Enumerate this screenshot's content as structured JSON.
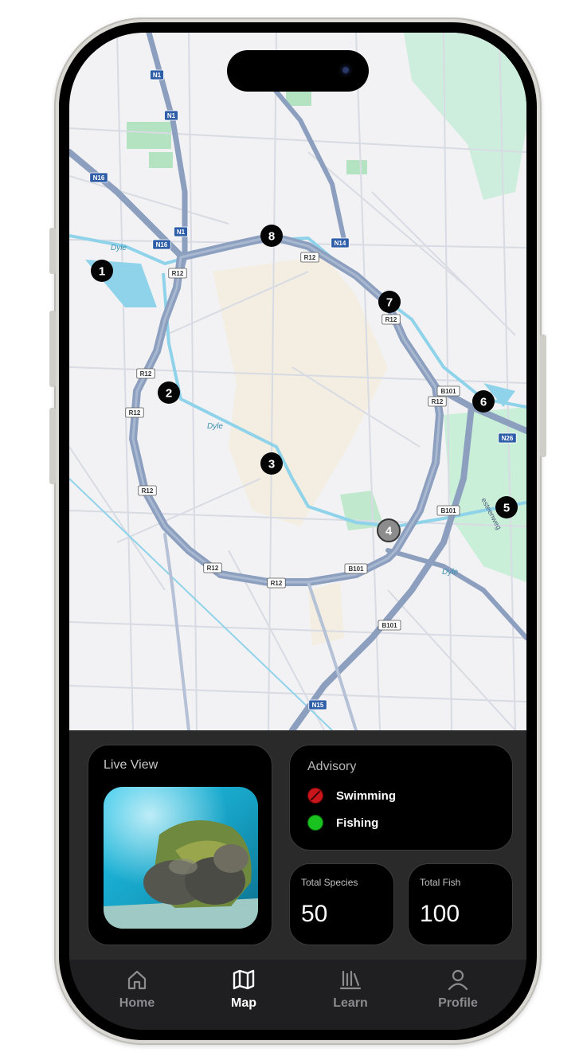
{
  "map": {
    "road_labels": [
      "N1",
      "N1",
      "N1",
      "N16",
      "N16",
      "N14",
      "R12",
      "R12",
      "R12",
      "R12",
      "R12",
      "R12",
      "R12",
      "R12",
      "R12",
      "B101",
      "B101",
      "B101",
      "B101",
      "N15",
      "N26",
      "Dyle",
      "Dyle",
      "Dyle",
      "esteenweg"
    ],
    "markers": [
      {
        "label": "1",
        "style": "dark"
      },
      {
        "label": "2",
        "style": "dark"
      },
      {
        "label": "3",
        "style": "dark"
      },
      {
        "label": "4",
        "style": "gray"
      },
      {
        "label": "5",
        "style": "dark"
      },
      {
        "label": "6",
        "style": "dark"
      },
      {
        "label": "7",
        "style": "dark"
      },
      {
        "label": "8",
        "style": "dark"
      }
    ]
  },
  "live_view": {
    "title": "Live View"
  },
  "advisory": {
    "title": "Advisory",
    "items": [
      {
        "label": "Swimming",
        "status": "prohibited",
        "color": "#c8161c"
      },
      {
        "label": "Fishing",
        "status": "allowed",
        "color": "#19c21f"
      }
    ]
  },
  "stats": {
    "total_species": {
      "label": "Total Species",
      "value": "50"
    },
    "total_fish": {
      "label": "Total Fish",
      "value": "100"
    }
  },
  "tabbar": {
    "tabs": [
      {
        "label": "Home",
        "icon": "home-icon",
        "active": false
      },
      {
        "label": "Map",
        "icon": "map-icon",
        "active": true
      },
      {
        "label": "Learn",
        "icon": "learn-icon",
        "active": false
      },
      {
        "label": "Profile",
        "icon": "profile-icon",
        "active": false
      }
    ]
  }
}
